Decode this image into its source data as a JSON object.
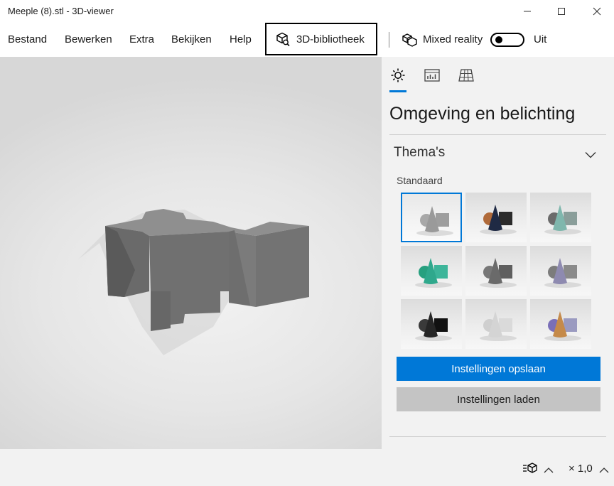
{
  "window": {
    "title": "Meeple (8).stl - 3D-viewer"
  },
  "menu": {
    "items": [
      "Bestand",
      "Bewerken",
      "Extra",
      "Bekijken",
      "Help"
    ],
    "library_label": "3D-bibliotheek",
    "mixed_reality_label": "Mixed reality",
    "toggle_state": "Uit"
  },
  "panel": {
    "tabs": [
      {
        "icon": "sun-icon"
      },
      {
        "icon": "stats-icon"
      },
      {
        "icon": "grid-icon"
      }
    ],
    "title": "Omgeving en belichting",
    "section_title": "Thema's",
    "sub_label": "Standaard",
    "themes": [
      {
        "cone": "#9a9a9a",
        "sphere": "#a8a8a8",
        "cube": "#9e9e9e",
        "selected": true
      },
      {
        "cone": "#1f2a44",
        "sphere": "#b06a3a",
        "cube": "#2b2b2b",
        "selected": false
      },
      {
        "cone": "#7fb7ad",
        "sphere": "#6b6b6b",
        "cube": "#8a9e9a",
        "selected": false
      },
      {
        "cone": "#2fa88c",
        "sphere": "#27a07f",
        "cube": "#3db59a",
        "selected": false
      },
      {
        "cone": "#6a6a6a",
        "sphere": "#777777",
        "cube": "#5f5f5f",
        "selected": false
      },
      {
        "cone": "#8e8ab0",
        "sphere": "#7c7c7c",
        "cube": "#8a8a8a",
        "selected": false
      },
      {
        "cone": "#262626",
        "sphere": "#3a3a3a",
        "cube": "#111111",
        "selected": false
      },
      {
        "cone": "#d4d4d4",
        "sphere": "#cfcfcf",
        "cube": "#dadada",
        "selected": false
      },
      {
        "cone": "#c58a4a",
        "sphere": "#7a6fb8",
        "cube": "#9a9ac0",
        "selected": false
      }
    ],
    "save_label": "Instellingen opslaan",
    "load_label": "Instellingen laden"
  },
  "statusbar": {
    "zoom": "× 1,0"
  },
  "colors": {
    "accent": "#0078d7",
    "model": "#707070",
    "panel_bg": "#f2f2f2"
  }
}
